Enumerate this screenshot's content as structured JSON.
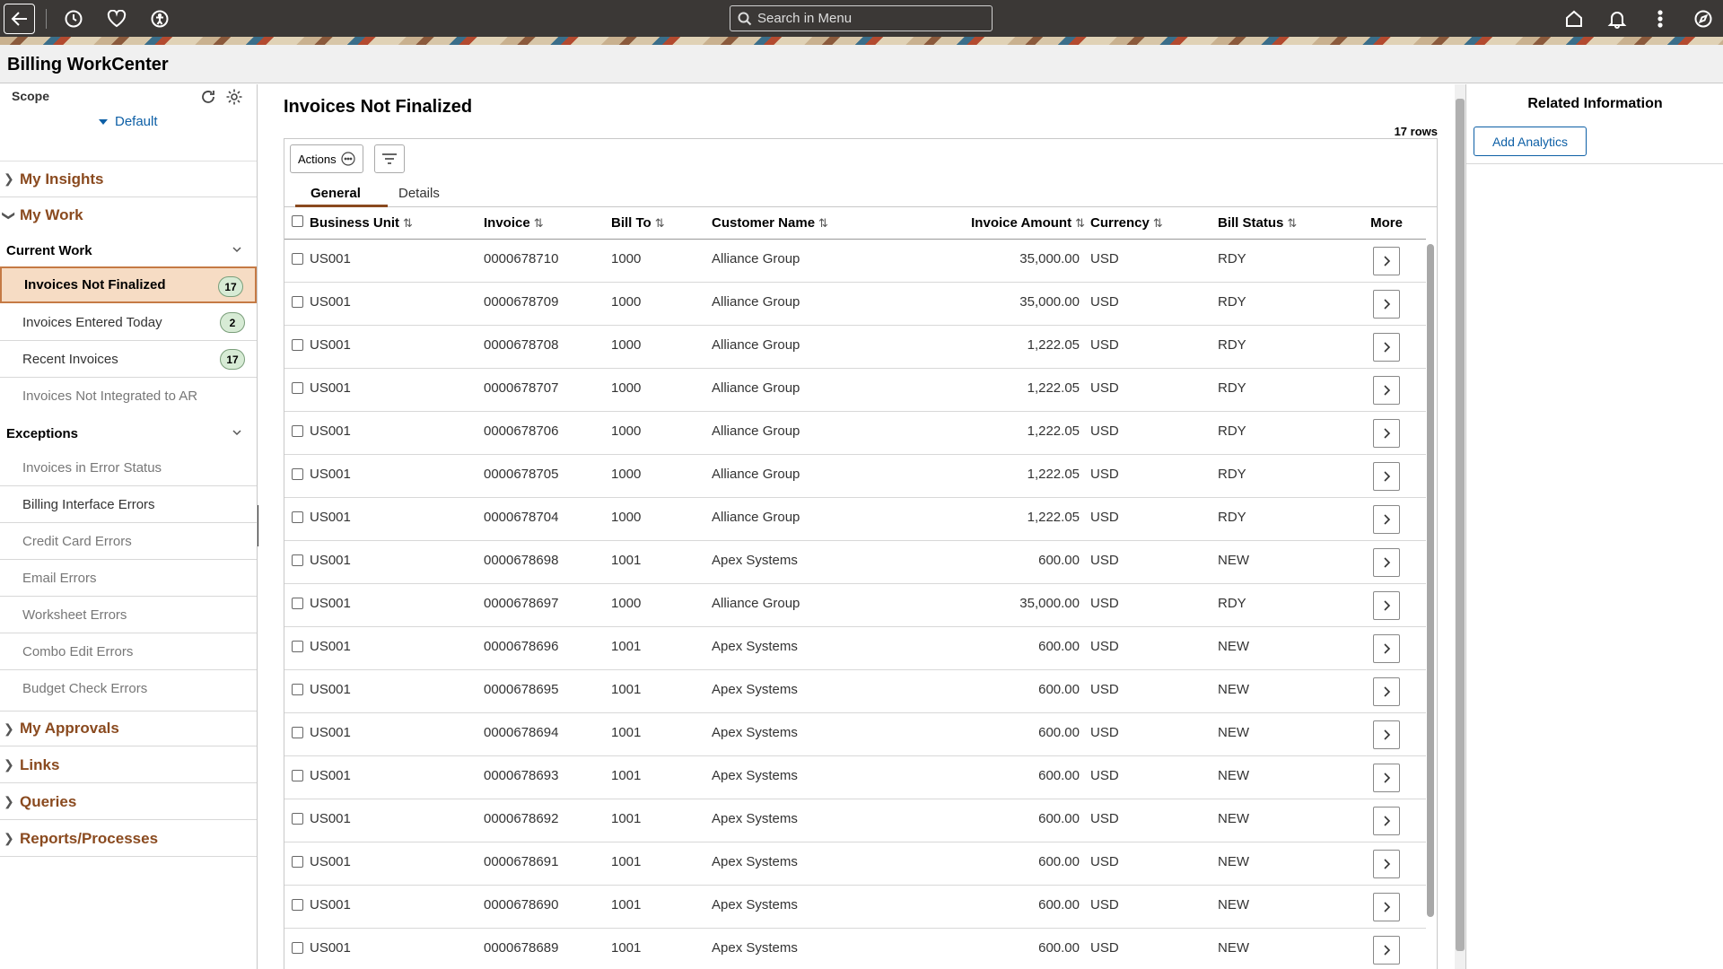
{
  "header": {
    "search_placeholder": "Search in Menu"
  },
  "page": {
    "title": "Billing WorkCenter"
  },
  "sidebar": {
    "scope_label": "Scope",
    "scope_value": "Default",
    "sections": {
      "my_insights": "My Insights",
      "my_work": "My Work",
      "my_approvals": "My Approvals",
      "links": "Links",
      "queries": "Queries",
      "reports": "Reports/Processes"
    },
    "current_work": {
      "label": "Current Work",
      "items": [
        {
          "label": "Invoices Not Finalized",
          "count": "17"
        },
        {
          "label": "Invoices Entered Today",
          "count": "2"
        },
        {
          "label": "Recent Invoices",
          "count": "17"
        },
        {
          "label": "Invoices Not Integrated to AR"
        }
      ]
    },
    "exceptions": {
      "label": "Exceptions",
      "items": [
        {
          "label": "Invoices in Error Status"
        },
        {
          "label": "Billing Interface Errors"
        },
        {
          "label": "Credit Card Errors"
        },
        {
          "label": "Email Errors"
        },
        {
          "label": "Worksheet Errors"
        },
        {
          "label": "Combo Edit Errors"
        },
        {
          "label": "Budget Check Errors"
        }
      ]
    }
  },
  "main": {
    "title": "Invoices Not Finalized",
    "rows_count": "17 rows",
    "actions_label": "Actions",
    "tabs": [
      "General",
      "Details"
    ],
    "columns": [
      "Business Unit",
      "Invoice",
      "Bill To",
      "Customer Name",
      "Invoice Amount",
      "Currency",
      "Bill Status",
      "More"
    ],
    "rows": [
      [
        "US001",
        "0000678710",
        "1000",
        "Alliance Group",
        "35,000.00",
        "USD",
        "RDY"
      ],
      [
        "US001",
        "0000678709",
        "1000",
        "Alliance Group",
        "35,000.00",
        "USD",
        "RDY"
      ],
      [
        "US001",
        "0000678708",
        "1000",
        "Alliance Group",
        "1,222.05",
        "USD",
        "RDY"
      ],
      [
        "US001",
        "0000678707",
        "1000",
        "Alliance Group",
        "1,222.05",
        "USD",
        "RDY"
      ],
      [
        "US001",
        "0000678706",
        "1000",
        "Alliance Group",
        "1,222.05",
        "USD",
        "RDY"
      ],
      [
        "US001",
        "0000678705",
        "1000",
        "Alliance Group",
        "1,222.05",
        "USD",
        "RDY"
      ],
      [
        "US001",
        "0000678704",
        "1000",
        "Alliance Group",
        "1,222.05",
        "USD",
        "RDY"
      ],
      [
        "US001",
        "0000678698",
        "1001",
        "Apex Systems",
        "600.00",
        "USD",
        "NEW"
      ],
      [
        "US001",
        "0000678697",
        "1000",
        "Alliance Group",
        "35,000.00",
        "USD",
        "RDY"
      ],
      [
        "US001",
        "0000678696",
        "1001",
        "Apex Systems",
        "600.00",
        "USD",
        "NEW"
      ],
      [
        "US001",
        "0000678695",
        "1001",
        "Apex Systems",
        "600.00",
        "USD",
        "NEW"
      ],
      [
        "US001",
        "0000678694",
        "1001",
        "Apex Systems",
        "600.00",
        "USD",
        "NEW"
      ],
      [
        "US001",
        "0000678693",
        "1001",
        "Apex Systems",
        "600.00",
        "USD",
        "NEW"
      ],
      [
        "US001",
        "0000678692",
        "1001",
        "Apex Systems",
        "600.00",
        "USD",
        "NEW"
      ],
      [
        "US001",
        "0000678691",
        "1001",
        "Apex Systems",
        "600.00",
        "USD",
        "NEW"
      ],
      [
        "US001",
        "0000678690",
        "1001",
        "Apex Systems",
        "600.00",
        "USD",
        "NEW"
      ],
      [
        "US001",
        "0000678689",
        "1001",
        "Apex Systems",
        "600.00",
        "USD",
        "NEW"
      ]
    ]
  },
  "related": {
    "title": "Related Information",
    "add_analytics": "Add Analytics"
  },
  "colors": {
    "topbar": "#3b3836",
    "section_heading": "#8a4a1f",
    "active_item_bg": "#f6dcc4",
    "active_item_border": "#c57a45",
    "count_badge_bg": "#d7ebd5",
    "link_blue": "#0d5fa6"
  },
  "icons": [
    "back-arrow-icon",
    "history-icon",
    "favorites-heart-icon",
    "accessibility-icon",
    "search-icon",
    "home-icon",
    "bell-icon",
    "kebab-menu-icon",
    "compass-icon",
    "refresh-icon",
    "gear-icon",
    "filter-icon",
    "ellipsis-circle-icon",
    "chevron-right-icon",
    "chevron-down-icon",
    "sort-icon"
  ]
}
